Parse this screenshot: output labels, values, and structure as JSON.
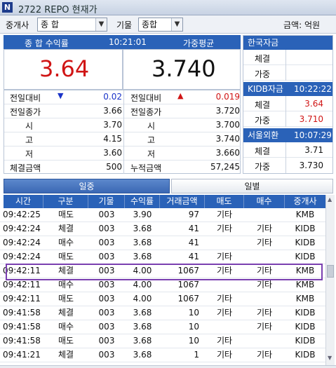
{
  "window": {
    "icon_text": "N",
    "title": "2722 REPO 현재가"
  },
  "toolbar": {
    "broker_label": "중개사",
    "broker_value": "종  합",
    "term_label": "기물",
    "term_value": "종합",
    "amount_label": "금액: 억원"
  },
  "quote": {
    "header_left": "종  합 수익률",
    "header_time": "10:21:01",
    "header_right": "가중평균",
    "big_yield": "3.64",
    "big_weighted": "3.740",
    "rows": [
      {
        "l_label": "전일대비",
        "l_value": "0.02",
        "r_label": "전일대비",
        "r_value": "0.019"
      },
      {
        "l_label": "전일종가",
        "l_value": "3.66",
        "r_label": "전일종가",
        "r_value": "3.720"
      },
      {
        "l_label": "시",
        "l_value": "3.70",
        "r_label": "시",
        "r_value": "3.700"
      },
      {
        "l_label": "고",
        "l_value": "4.15",
        "r_label": "고",
        "r_value": "3.740"
      },
      {
        "l_label": "저",
        "l_value": "3.60",
        "r_label": "저",
        "r_value": "3.660"
      },
      {
        "l_label": "체결금액",
        "l_value": "500",
        "r_label": "누적금액",
        "r_value": "57,245"
      }
    ],
    "down_arrow": "▼",
    "up_arrow": "▲"
  },
  "side": {
    "hk": {
      "title": "한국자금",
      "rows": [
        {
          "label": "체결",
          "value": ""
        },
        {
          "label": "가중",
          "value": ""
        }
      ]
    },
    "kidb": {
      "title": "KIDB자금",
      "time": "10:22:22",
      "rows": [
        {
          "label": "체결",
          "value": "3.64"
        },
        {
          "label": "가중",
          "value": "3.710"
        }
      ]
    },
    "seoul": {
      "title": "서울외환",
      "time": "10:07:29",
      "rows": [
        {
          "label": "체결",
          "value": "3.71"
        },
        {
          "label": "가중",
          "value": "3.730"
        }
      ]
    }
  },
  "tabs": {
    "daily": "일중",
    "by_day": "일별"
  },
  "trades": {
    "headers": [
      "시간",
      "구분",
      "기물",
      "수익률",
      "거래금액",
      "매도",
      "매수",
      "중개사"
    ],
    "rows": [
      [
        "09:42:25",
        "매도",
        "003",
        "3.90",
        "97",
        "기타",
        "",
        "KMB"
      ],
      [
        "09:42:24",
        "체결",
        "003",
        "3.68",
        "41",
        "기타",
        "기타",
        "KIDB"
      ],
      [
        "09:42:24",
        "매수",
        "003",
        "3.68",
        "41",
        "",
        "기타",
        "KIDB"
      ],
      [
        "09:42:24",
        "매도",
        "003",
        "3.68",
        "41",
        "기타",
        "",
        "KIDB"
      ],
      [
        "09:42:11",
        "체결",
        "003",
        "4.00",
        "1067",
        "기타",
        "기타",
        "KMB"
      ],
      [
        "09:42:11",
        "매수",
        "003",
        "4.00",
        "1067",
        "",
        "기타",
        "KMB"
      ],
      [
        "09:42:11",
        "매도",
        "003",
        "4.00",
        "1067",
        "기타",
        "",
        "KMB"
      ],
      [
        "09:41:58",
        "체결",
        "003",
        "3.68",
        "10",
        "기타",
        "기타",
        "KIDB"
      ],
      [
        "09:41:58",
        "매수",
        "003",
        "3.68",
        "10",
        "",
        "기타",
        "KIDB"
      ],
      [
        "09:41:58",
        "매도",
        "003",
        "3.68",
        "10",
        "기타",
        "",
        "KIDB"
      ],
      [
        "09:41:21",
        "체결",
        "003",
        "3.68",
        "1",
        "기타",
        "기타",
        "KIDB"
      ]
    ],
    "highlight_row": 4
  },
  "colors": {
    "header_blue": "#2a62b8",
    "up_red": "#d01515",
    "down_blue": "#1a33c8",
    "highlight": "#7a3fb0"
  }
}
